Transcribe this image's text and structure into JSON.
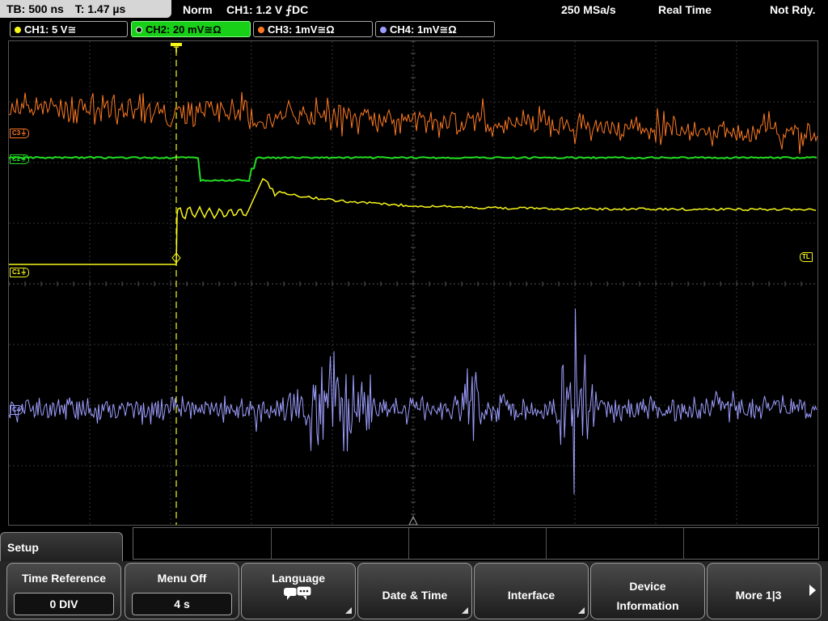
{
  "status_bar": {
    "timebase": "TB: 500 ns",
    "trigger_time": "T: 1.47 µs",
    "acq_mode": "Norm",
    "trigger_info": "CH1: 1.2 V ⨍DC",
    "sample_rate": "250 MSa/s",
    "mode": "Real Time",
    "trigger_state": "Not Rdy."
  },
  "channels": [
    {
      "label": "CH1: 5 V≅",
      "color": "#f7f71a"
    },
    {
      "label": "CH2: 20 mV≅Ω",
      "color": "#22dd22",
      "active": true
    },
    {
      "label": "CH3: 1mV≅Ω",
      "color": "#ff7a22"
    },
    {
      "label": "CH4: 1mV≅Ω",
      "color": "#9d9dff"
    }
  ],
  "markers": {
    "ch1": "C1⏚",
    "ch2": "C2⏚",
    "ch3": "C3⏚",
    "ch4": "C4",
    "trigger_level": "TL",
    "trigger_pos": "T"
  },
  "menu": {
    "title": "Setup",
    "softkeys": [
      {
        "label": "Time Reference",
        "value": "0 DIV"
      },
      {
        "label": "Menu Off",
        "value": "4 s"
      },
      {
        "label": "Language",
        "icon": "speech-bubble-icon"
      },
      {
        "label": "Date & Time"
      },
      {
        "label": "Interface"
      },
      {
        "label_line1": "Device",
        "label_line2": "Information"
      },
      {
        "label": "More 1|3"
      }
    ]
  }
}
